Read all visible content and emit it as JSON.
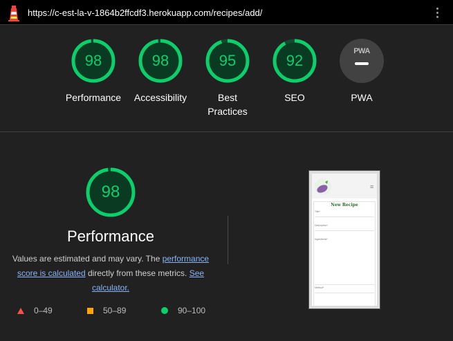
{
  "header": {
    "url": "https://c-est-la-v-1864b2ffcdf3.herokuapp.com/recipes/add/",
    "menu_icon": "kebab-menu-icon",
    "logo_icon": "lighthouse-icon"
  },
  "colors": {
    "pass": "#0cce6b",
    "average": "#ffa400",
    "fail": "#ff4e42",
    "link": "#8ab4f8",
    "background": "#212121"
  },
  "categories": [
    {
      "label": "Performance",
      "score": 98
    },
    {
      "label": "Accessibility",
      "score": 98
    },
    {
      "label": "Best Practices",
      "label_line1": "Best",
      "label_line2": "Practices",
      "score": 95
    },
    {
      "label": "SEO",
      "score": 92
    },
    {
      "label": "PWA",
      "badge": "PWA",
      "score": null
    }
  ],
  "performance": {
    "score": 98,
    "title": "Performance",
    "desc_before": "Values are estimated and may vary. The ",
    "link1": "performance score is calculated",
    "desc_middle": " directly from these metrics. ",
    "link2": "See calculator."
  },
  "legend": [
    {
      "range": "0–49",
      "icon": "triangle-icon"
    },
    {
      "range": "50–89",
      "icon": "square-icon"
    },
    {
      "range": "90–100",
      "icon": "circle-icon"
    }
  ],
  "screenshot": {
    "page_title": "New Recipe",
    "menu_glyph": "≡",
    "fields": [
      "Title*",
      "Description*",
      "Ingredients*",
      "Method*"
    ]
  }
}
